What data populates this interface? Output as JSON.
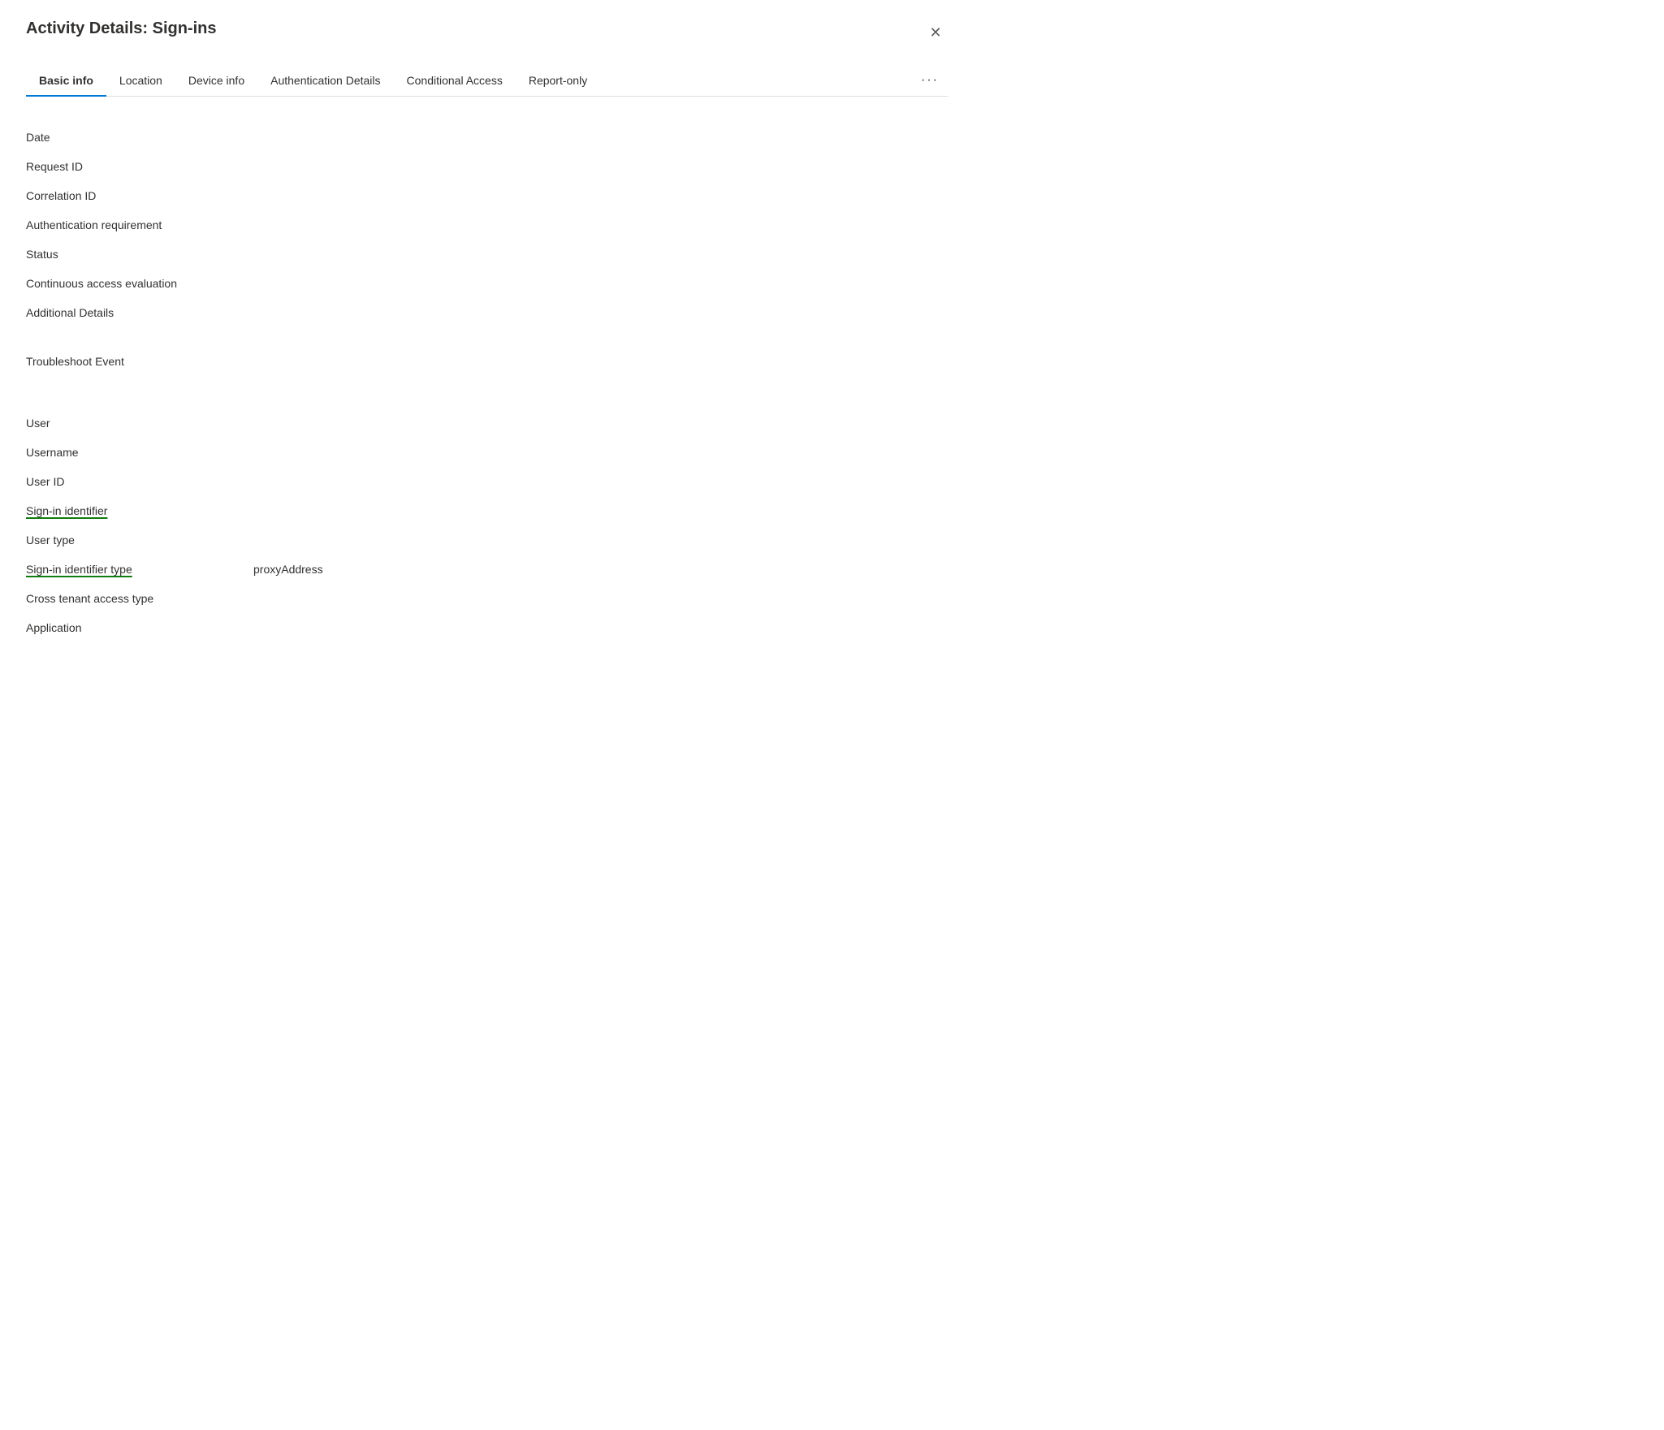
{
  "dialog": {
    "title": "Activity Details: Sign-ins",
    "close_label": "✕"
  },
  "tabs": {
    "items": [
      {
        "id": "basic-info",
        "label": "Basic info",
        "active": true
      },
      {
        "id": "location",
        "label": "Location",
        "active": false
      },
      {
        "id": "device-info",
        "label": "Device info",
        "active": false
      },
      {
        "id": "authentication-details",
        "label": "Authentication Details",
        "active": false
      },
      {
        "id": "conditional-access",
        "label": "Conditional Access",
        "active": false
      },
      {
        "id": "report-only",
        "label": "Report-only",
        "active": false
      }
    ],
    "more_label": "···"
  },
  "fields": {
    "group1": [
      {
        "id": "date",
        "label": "Date",
        "value": "",
        "underlined": false
      },
      {
        "id": "request-id",
        "label": "Request ID",
        "value": "",
        "underlined": false
      },
      {
        "id": "correlation-id",
        "label": "Correlation ID",
        "value": "",
        "underlined": false
      },
      {
        "id": "auth-requirement",
        "label": "Authentication requirement",
        "value": "",
        "underlined": false
      },
      {
        "id": "status",
        "label": "Status",
        "value": "",
        "underlined": false
      },
      {
        "id": "continuous-access",
        "label": "Continuous access evaluation",
        "value": "",
        "underlined": false
      },
      {
        "id": "additional-details",
        "label": "Additional Details",
        "value": "",
        "underlined": false
      }
    ],
    "group2": [
      {
        "id": "troubleshoot-event",
        "label": "Troubleshoot Event",
        "value": "",
        "underlined": false
      }
    ],
    "group3": [
      {
        "id": "user",
        "label": "User",
        "value": "",
        "underlined": false
      },
      {
        "id": "username",
        "label": "Username",
        "value": "",
        "underlined": false
      },
      {
        "id": "user-id",
        "label": "User ID",
        "value": "",
        "underlined": false
      },
      {
        "id": "sign-in-identifier",
        "label": "Sign-in identifier",
        "value": "",
        "underlined": true
      },
      {
        "id": "user-type",
        "label": "User type",
        "value": "",
        "underlined": false
      },
      {
        "id": "sign-in-identifier-type",
        "label": "Sign-in identifier type",
        "value": "proxyAddress",
        "underlined": true
      },
      {
        "id": "cross-tenant-access-type",
        "label": "Cross tenant access type",
        "value": "",
        "underlined": false
      },
      {
        "id": "application",
        "label": "Application",
        "value": "",
        "underlined": false
      }
    ]
  }
}
